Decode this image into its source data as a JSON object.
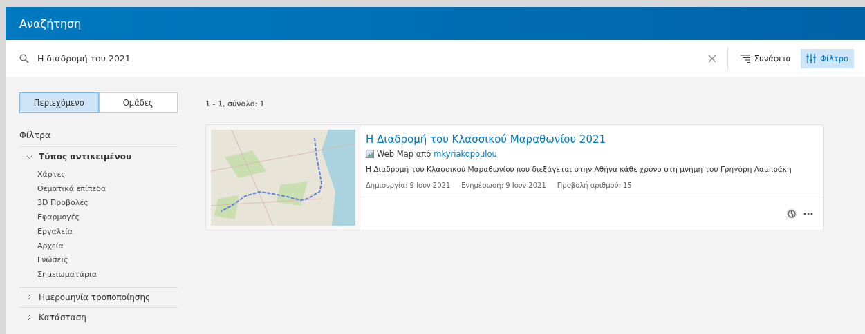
{
  "window": {
    "title": "Αναζήτηση"
  },
  "search": {
    "value": "Η διαδρομή του 2021"
  },
  "toolbar": [
    {
      "kind": "sort",
      "label": "Συνάφεια",
      "selected": false
    },
    {
      "kind": "filter",
      "label": "Φίλτρο",
      "selected": true
    }
  ],
  "view_tabs": [
    {
      "label": "Περιεχόμενο",
      "selected": true
    },
    {
      "label": "Ομάδες",
      "selected": false
    }
  ],
  "filters": {
    "title": "Φίλτρα",
    "groups": [
      {
        "label": "Τύπος αντικειμένου",
        "expanded": true,
        "children": [
          {
            "label": "Χάρτες"
          },
          {
            "label": "Θεματικά επίπεδα"
          },
          {
            "label": "3D Προβολές"
          },
          {
            "label": "Εφαρμογές"
          },
          {
            "label": "Εργαλεία"
          },
          {
            "label": "Αρχεία"
          },
          {
            "label": "Γνώσεις"
          },
          {
            "label": "Σημειωματάρια"
          }
        ]
      },
      {
        "label": "Ημερομηνία τροποποίησης",
        "expanded": false
      },
      {
        "label": "Κατάσταση",
        "expanded": false
      }
    ]
  },
  "results": {
    "count": "1 - 1, σύνολο: 1",
    "items": [
      {
        "title": "Η Διαδρομή του Κλασσικού Μαραθωνίου 2021",
        "type": "Web Map από",
        "owner": "mkyriakopoulou",
        "description": "Η Διαδρομή του Κλασσικού Μαραθωνίου που διεξάγεται στην Αθήνα κάθε χρόνο στη μνήμη του Γρηγόρη Λαμπράκη",
        "meta": [
          "Δημιουργία: 9 Ιουν 2021",
          "Ενημέρωση: 9 Ιουν 2021",
          "Προβολή αριθμού: 15"
        ]
      }
    ]
  }
}
